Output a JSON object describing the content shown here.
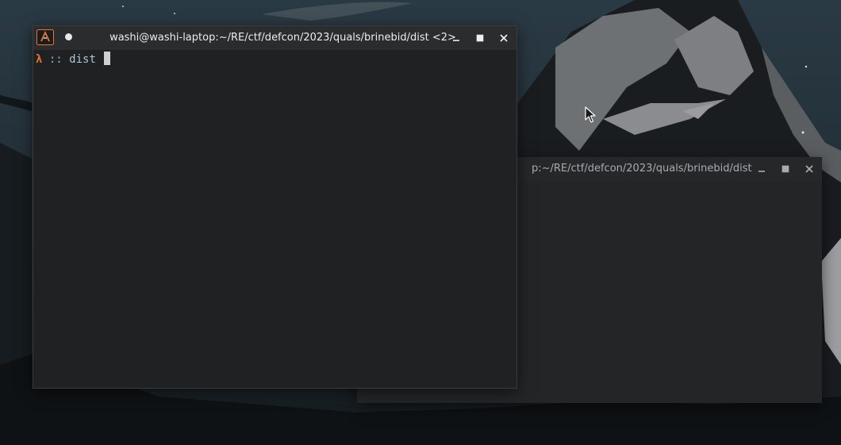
{
  "desktop": {
    "wallpaper": "dark mountain night sky",
    "accent_colors": {
      "sky": "#26343d",
      "mountain_dark": "#1a1d20",
      "mountain_light": "#7d7f82",
      "prompt_lambda": "#e0703a"
    }
  },
  "windows": {
    "front": {
      "title": "washi@washi-laptop:~/RE/ctf/defcon/2023/quals/brinebid/dist <2>",
      "app_icon": "konsole-terminal-icon",
      "controls": [
        "minimize-icon",
        "maximize-icon",
        "close-icon"
      ],
      "terminal": {
        "prompt_symbol": "λ",
        "prompt_separator": "::",
        "prompt_dir": "dist"
      }
    },
    "back": {
      "title_visible": "p:~/RE/ctf/defcon/2023/quals/brinebid/dist",
      "controls": [
        "minimize-icon",
        "maximize-icon",
        "close-icon"
      ]
    }
  }
}
